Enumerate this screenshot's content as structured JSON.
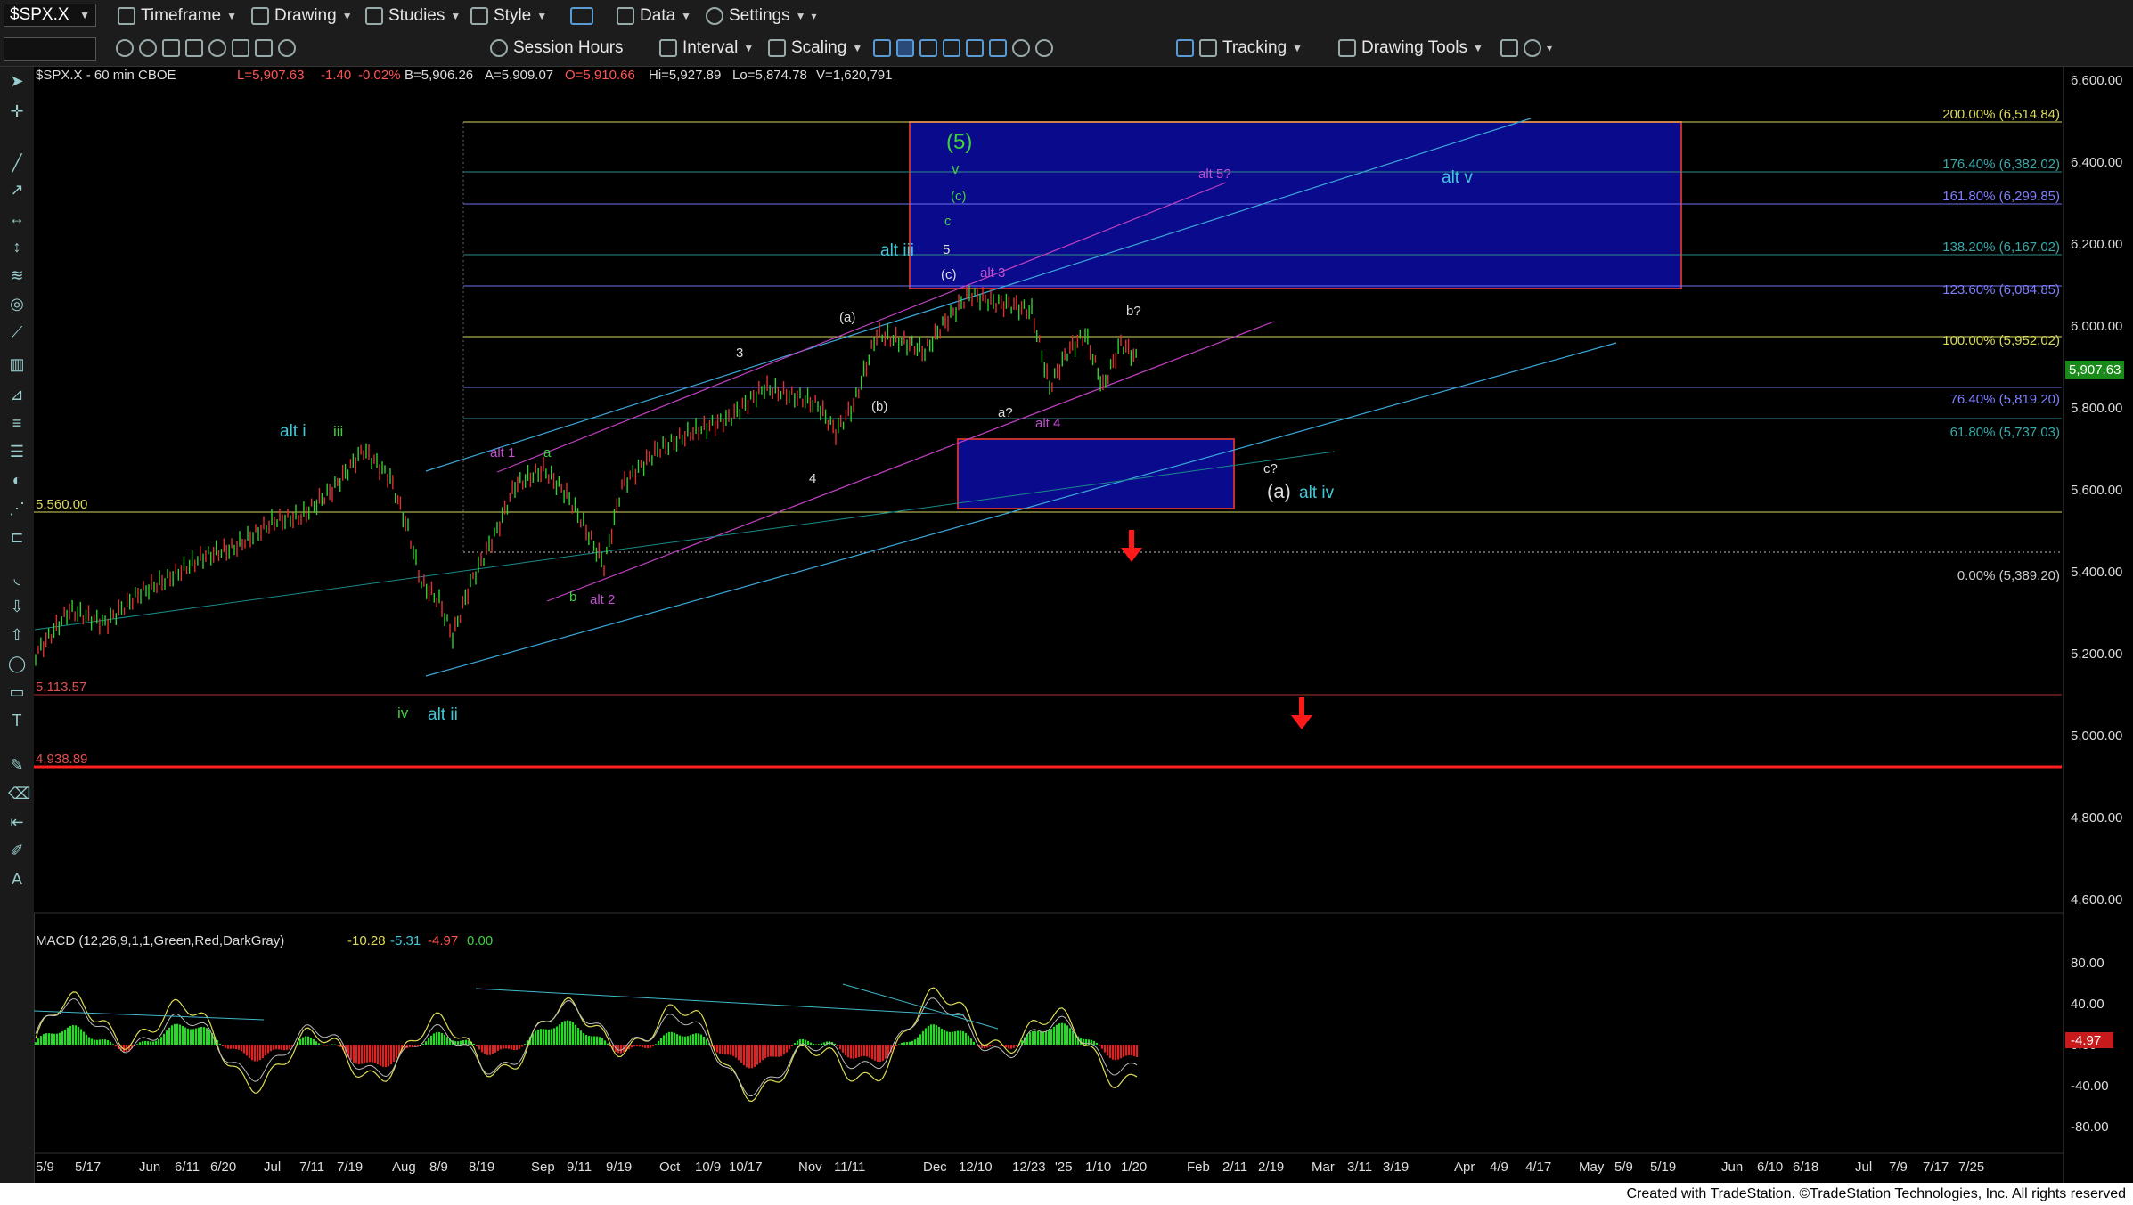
{
  "toolbar1": {
    "symbol": "$SPX.X",
    "timeframe": "Timeframe",
    "drawing": "Drawing",
    "studies": "Studies",
    "style": "Style",
    "data": "Data",
    "settings": "Settings"
  },
  "toolbar2": {
    "session_hours": "Session Hours",
    "interval": "Interval",
    "scaling": "Scaling",
    "tracking": "Tracking",
    "drawing_tools": "Drawing Tools"
  },
  "header": {
    "title": "$SPX.X - 60 min  CBOE",
    "last": "L=5,907.63",
    "change": "-1.40",
    "pct": "-0.02%",
    "bid": "B=5,906.26",
    "ask": "A=5,909.07",
    "open": "O=5,910.66",
    "high": "Hi=5,927.89",
    "low": "Lo=5,874.78",
    "volume": "V=1,620,791"
  },
  "price_axis": [
    "6,600.00",
    "6,400.00",
    "6,200.00",
    "6,000.00",
    "5,800.00",
    "5,600.00",
    "5,400.00",
    "5,200.00",
    "5,000.00",
    "4,800.00",
    "4,600.00"
  ],
  "current_price": "5,907.63",
  "fib_levels": [
    {
      "label": "200.00% (6,514.84)",
      "color": "#d8d860"
    },
    {
      "label": "176.40% (6,382.02)",
      "color": "#3aa8a8"
    },
    {
      "label": "161.80% (6,299.85)",
      "color": "#7f7fff"
    },
    {
      "label": "138.20% (6,167.02)",
      "color": "#3aa8a8"
    },
    {
      "label": "123.60% (6,084.85)",
      "color": "#7f7fff"
    },
    {
      "label": "100.00% (5,952.02)",
      "color": "#d8d860"
    },
    {
      "label": "76.40% (5,819.20)",
      "color": "#7f7fff"
    },
    {
      "label": "61.80% (5,737.03)",
      "color": "#3aa8a8"
    },
    {
      "label": "0.00% (5,389.20)",
      "color": "#cccccc"
    }
  ],
  "left_levels": [
    {
      "label": "5,560.00",
      "color": "#d8d860"
    },
    {
      "label": "5,113.57",
      "color": "#e05050"
    },
    {
      "label": "4,938.89",
      "color": "#e05050"
    }
  ],
  "wave_labels": {
    "wave5": "(5)",
    "v": "v",
    "c_paren": "(c)",
    "c": "c",
    "five": "5",
    "c_paren2": "(c)",
    "alt_iii": "alt iii",
    "alt_3": "alt 3",
    "alt_5q": "alt 5?",
    "alt_v": "alt v",
    "a_paren": "(a)",
    "b_paren": "(b)",
    "three": "3",
    "four": "4",
    "b_q": "b?",
    "a_q": "a?",
    "alt_4": "alt 4",
    "c_q": "c?",
    "a_big": "(a)",
    "alt_iv": "alt iv",
    "alt_i": "alt i",
    "iii": "iii",
    "alt_1": "alt 1",
    "a_small": "a",
    "b_small": "b",
    "alt_2": "alt 2",
    "iv": "iv",
    "alt_ii": "alt ii"
  },
  "macd": {
    "title": "MACD (12,26,9,1,1,Green,Red,DarkGray)",
    "v1": "-10.28",
    "v2": "-5.31",
    "v3": "-4.97",
    "v4": "0.00",
    "current": "-4.97",
    "axis": [
      "80.00",
      "40.00",
      "0.00",
      "-40.00",
      "-80.00"
    ]
  },
  "date_axis": [
    "5/9",
    "5/17",
    "Jun",
    "6/11",
    "6/20",
    "Jul",
    "7/11",
    "7/19",
    "Aug",
    "8/9",
    "8/19",
    "Sep",
    "9/11",
    "9/19",
    "Oct",
    "10/9",
    "10/17",
    "Nov",
    "11/11",
    "Dec",
    "12/10",
    "12/23",
    "'25",
    "1/10",
    "1/20",
    "Feb",
    "2/11",
    "2/19",
    "Mar",
    "3/11",
    "3/19",
    "Apr",
    "4/9",
    "4/17",
    "May",
    "5/9",
    "5/19",
    "Jun",
    "6/10",
    "6/18",
    "Jul",
    "7/9",
    "7/17",
    "7/25"
  ],
  "footer": "Created with TradeStation. ©TradeStation Technologies, Inc. All rights reserved"
}
